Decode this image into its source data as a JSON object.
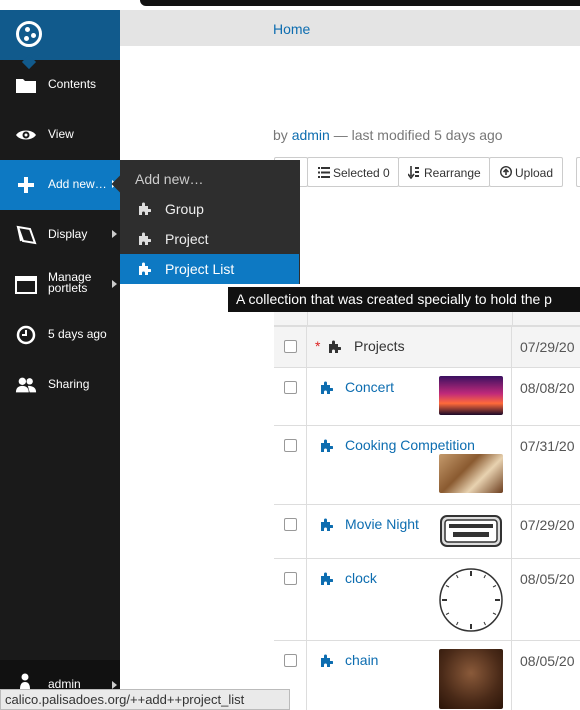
{
  "toolbar": {
    "items": [
      {
        "label": "Contents",
        "icon": "folder-icon"
      },
      {
        "label": "View",
        "icon": "eye-icon"
      },
      {
        "label": "Add new…",
        "icon": "plus-icon"
      },
      {
        "label": "Display",
        "icon": "display-icon"
      },
      {
        "label_line1": "Manage",
        "label_line2": "portlets",
        "icon": "portlets-icon"
      },
      {
        "label": "5 days ago",
        "icon": "clock-icon"
      },
      {
        "label": "Sharing",
        "icon": "users-icon"
      }
    ],
    "user": "admin"
  },
  "submenu": {
    "heading": "Add new…",
    "items": [
      {
        "label": "Group"
      },
      {
        "label": "Project"
      },
      {
        "label": "Project List"
      }
    ]
  },
  "breadcrumb": {
    "home": "Home"
  },
  "byline": {
    "by": "by",
    "author": "admin",
    "rest": "— last modified 5 days ago"
  },
  "buttons": {
    "selected": "Selected 0",
    "rearrange": "Rearrange",
    "upload": "Upload"
  },
  "tooltip": "A collection that was created specially to hold the p",
  "table": {
    "rows": [
      {
        "title": "Projects",
        "date": "07/29/20"
      },
      {
        "title": "Concert",
        "date": "08/08/20"
      },
      {
        "title": "Cooking Competition",
        "date": "07/31/20"
      },
      {
        "title": "Movie Night",
        "date": "07/29/20"
      },
      {
        "title": "clock",
        "date": "08/05/20"
      },
      {
        "title": "chain",
        "date": "08/05/20"
      }
    ]
  },
  "status_url": "calico.palisadoes.org/++add++project_list",
  "colors": {
    "toolbar": "#1a1a1a",
    "accent": "#0d79c3",
    "link": "#0d6db0"
  }
}
